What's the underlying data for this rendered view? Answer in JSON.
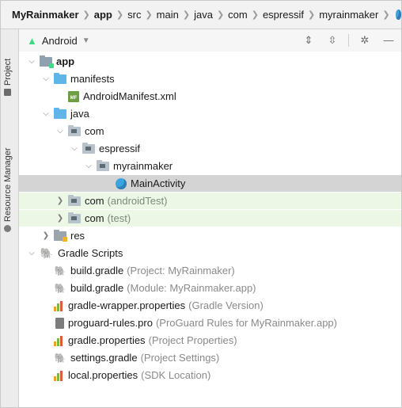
{
  "breadcrumb": {
    "items": [
      "MyRainmaker",
      "app",
      "src",
      "main",
      "java",
      "com",
      "espressif",
      "myrainmaker"
    ]
  },
  "left_strip": {
    "project_tab": "Project",
    "resource_tab": "Resource Manager"
  },
  "panel": {
    "view_selector": "Android"
  },
  "tree": {
    "app": "app",
    "manifests": "manifests",
    "android_manifest": "AndroidManifest.xml",
    "java": "java",
    "com": "com",
    "espressif": "espressif",
    "myrainmaker": "myrainmaker",
    "main_activity": "MainActivity",
    "com_android_test": "com",
    "com_android_test_hint": "(androidTest)",
    "com_test": "com",
    "com_test_hint": "(test)",
    "res": "res",
    "gradle_scripts": "Gradle Scripts",
    "build_gradle_project": "build.gradle",
    "build_gradle_project_hint": "(Project: MyRainmaker)",
    "build_gradle_module": "build.gradle",
    "build_gradle_module_hint": "(Module: MyRainmaker.app)",
    "gradle_wrapper": "gradle-wrapper.properties",
    "gradle_wrapper_hint": "(Gradle Version)",
    "proguard": "proguard-rules.pro",
    "proguard_hint": "(ProGuard Rules for MyRainmaker.app)",
    "gradle_properties": "gradle.properties",
    "gradle_properties_hint": "(Project Properties)",
    "settings_gradle": "settings.gradle",
    "settings_gradle_hint": "(Project Settings)",
    "local_properties": "local.properties",
    "local_properties_hint": "(SDK Location)"
  },
  "colors": {
    "selection": "#d4d4d4",
    "test_tint": "#ecf7e6",
    "folder_blue": "#5fb5e8",
    "android_green": "#3ddc84"
  }
}
